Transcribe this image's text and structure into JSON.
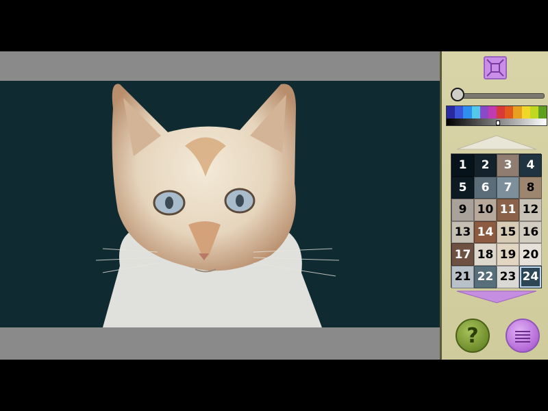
{
  "canvas": {
    "background_color": "#8a8a8a",
    "artwork_background_color": "#0f2a31",
    "subject": "cat-portrait"
  },
  "side_panel": {
    "fit_button_icon": "fit-screen-icon",
    "zoom_level": 0.0,
    "palette_hues": [
      "#2a2aa0",
      "#3a55d8",
      "#2f8ff0",
      "#53c8e8",
      "#8a4ac8",
      "#c03ab0",
      "#d83a3a",
      "#e25a1a",
      "#e8a020",
      "#f0d828",
      "#c0d820",
      "#60a020"
    ],
    "gray_value": 0.5,
    "scroll_up_icon": "triangle-up-icon",
    "scroll_down_icon": "triangle-down-icon",
    "color_grid": [
      {
        "number": "1",
        "bg": "#07131a",
        "fg": "#ffffff"
      },
      {
        "number": "2",
        "bg": "#14222b",
        "fg": "#ffffff"
      },
      {
        "number": "3",
        "bg": "#8f7d71",
        "fg": "#ffffff"
      },
      {
        "number": "4",
        "bg": "#1f3440",
        "fg": "#ffffff"
      },
      {
        "number": "5",
        "bg": "#0c1a22",
        "fg": "#ffffff"
      },
      {
        "number": "6",
        "bg": "#5a6d78",
        "fg": "#ffffff"
      },
      {
        "number": "7",
        "bg": "#7d8f9b",
        "fg": "#ffffff"
      },
      {
        "number": "8",
        "bg": "#9d8670",
        "fg": "#000000"
      },
      {
        "number": "9",
        "bg": "#a9a29a",
        "fg": "#000000"
      },
      {
        "number": "10",
        "bg": "#b7a99c",
        "fg": "#000000"
      },
      {
        "number": "11",
        "bg": "#8a6249",
        "fg": "#ffffff"
      },
      {
        "number": "12",
        "bg": "#c9c3b7",
        "fg": "#000000"
      },
      {
        "number": "13",
        "bg": "#c5beb2",
        "fg": "#000000"
      },
      {
        "number": "14",
        "bg": "#8b5a40",
        "fg": "#ffffff"
      },
      {
        "number": "15",
        "bg": "#d8cbb6",
        "fg": "#000000"
      },
      {
        "number": "16",
        "bg": "#d2cdc1",
        "fg": "#000000"
      },
      {
        "number": "17",
        "bg": "#6e5143",
        "fg": "#ffffff"
      },
      {
        "number": "18",
        "bg": "#ddd7cc",
        "fg": "#000000"
      },
      {
        "number": "19",
        "bg": "#e2d5c2",
        "fg": "#000000"
      },
      {
        "number": "20",
        "bg": "#e6e2da",
        "fg": "#000000"
      },
      {
        "number": "21",
        "bg": "#b8c1c8",
        "fg": "#000000"
      },
      {
        "number": "22",
        "bg": "#576e7b",
        "fg": "#ffffff"
      },
      {
        "number": "23",
        "bg": "#dad9d6",
        "fg": "#000000"
      },
      {
        "number": "24",
        "bg": "#2c4656",
        "fg": "#ffffff"
      }
    ],
    "selected_color": "24",
    "help_button": {
      "label": "?",
      "icon": "question-icon"
    },
    "menu_button_icon": "menu-lines-icon"
  }
}
